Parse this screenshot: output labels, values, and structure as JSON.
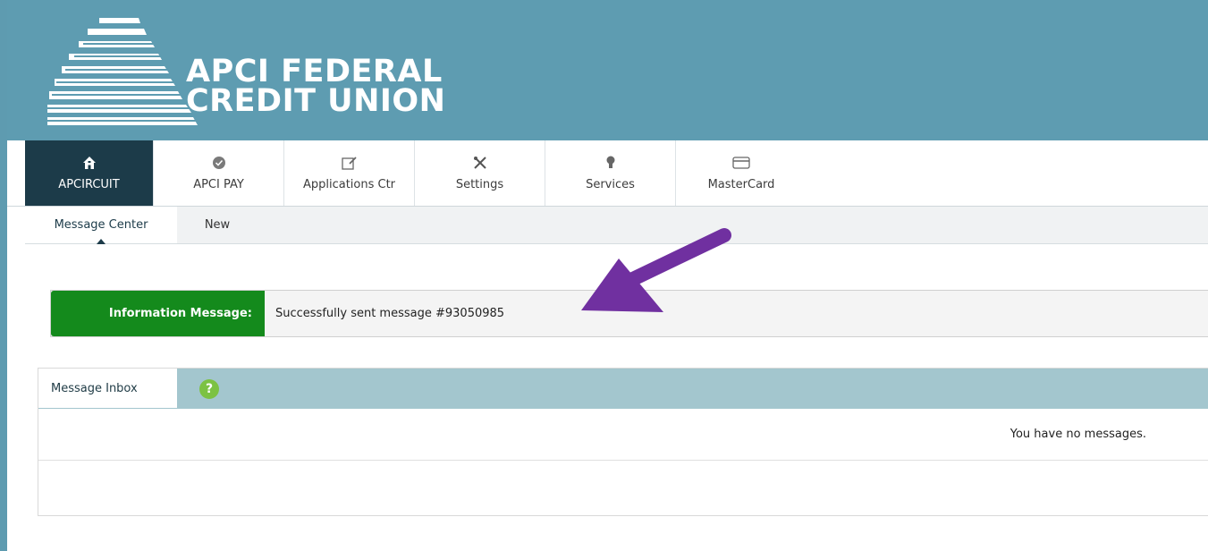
{
  "brand": {
    "name_line1": "APCI FEDERAL",
    "name_line2": "CREDIT UNION"
  },
  "nav": {
    "items": [
      {
        "label": "APCIRCUIT",
        "icon": "home-icon",
        "active": true
      },
      {
        "label": "APCI PAY",
        "icon": "check-circle-icon",
        "active": false
      },
      {
        "label": "Applications Ctr",
        "icon": "edit-icon",
        "active": false
      },
      {
        "label": "Settings",
        "icon": "tools-icon",
        "active": false
      },
      {
        "label": "Services",
        "icon": "lightbulb-icon",
        "active": false
      },
      {
        "label": "MasterCard",
        "icon": "credit-card-icon",
        "active": false
      }
    ]
  },
  "subnav": {
    "items": [
      {
        "label": "Message Center",
        "active": true
      },
      {
        "label": "New",
        "active": false
      }
    ]
  },
  "info_message": {
    "label": "Information Message:",
    "text": "Successfully sent message #93050985"
  },
  "inbox": {
    "title": "Message Inbox",
    "help": "?",
    "empty_text": "You have no messages."
  },
  "colors": {
    "banner": "#5e9cb1",
    "nav_active": "#1c3b49",
    "info_label": "#148a1c",
    "inbox_header": "#a3c6ce",
    "arrow": "#7030a0",
    "help_icon": "#7cc243"
  }
}
